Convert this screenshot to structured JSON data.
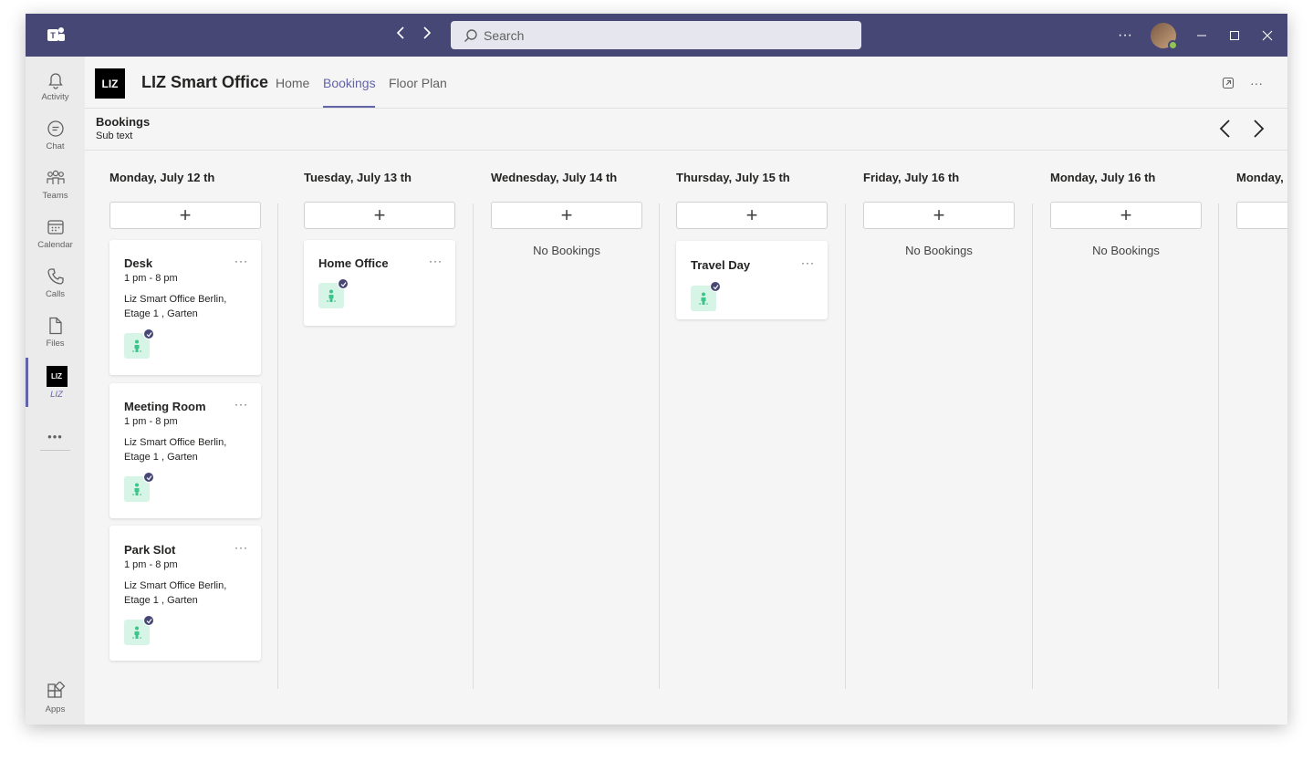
{
  "titlebar": {
    "search_placeholder": "Search",
    "more": "···"
  },
  "rail": {
    "items": [
      {
        "label": "Activity",
        "icon": "bell-icon"
      },
      {
        "label": "Chat",
        "icon": "chat-icon"
      },
      {
        "label": "Teams",
        "icon": "teams-icon"
      },
      {
        "label": "Calendar",
        "icon": "calendar-icon"
      },
      {
        "label": "Calls",
        "icon": "phone-icon"
      },
      {
        "label": "Files",
        "icon": "file-icon"
      },
      {
        "label": "LIZ",
        "icon": "liz-icon"
      },
      {
        "label": "Apps",
        "icon": "apps-icon"
      }
    ],
    "more": "•••",
    "liz_mark": "LIZ"
  },
  "header": {
    "logo_text": "LIZ",
    "title": "LIZ Smart Office",
    "tabs": [
      {
        "label": "Home"
      },
      {
        "label": "Bookings"
      },
      {
        "label": "Floor Plan"
      }
    ],
    "more": "···"
  },
  "subheader": {
    "title": "Bookings",
    "subtext": "Sub text"
  },
  "days": [
    {
      "title": "Monday, July 12 th"
    },
    {
      "title": "Tuesday, July 13 th"
    },
    {
      "title": "Wednesday, July 14 th",
      "empty": "No Bookings"
    },
    {
      "title": "Thursday, July 15 th"
    },
    {
      "title": "Friday, July 16 th",
      "empty": "No Bookings"
    },
    {
      "title": "Monday, July 16 th",
      "empty": "No Bookings"
    },
    {
      "title": "Monday,"
    }
  ],
  "bookings": {
    "desk": {
      "title": "Desk",
      "time": "1 pm - 8 pm",
      "location": "Liz Smart Office Berlin, Etage 1 , Garten"
    },
    "meeting": {
      "title": "Meeting Room",
      "time": "1 pm - 8 pm",
      "location": "Liz Smart Office Berlin, Etage 1 , Garten"
    },
    "park": {
      "title": "Park Slot",
      "time": "1 pm - 8 pm",
      "location": "Liz Smart Office Berlin, Etage 1 , Garten"
    },
    "home": {
      "title": "Home Office"
    },
    "travel": {
      "title": "Travel Day"
    }
  },
  "add_label": "+",
  "card_more": "···",
  "colors": {
    "titlebar": "#464775",
    "accent": "#6264a7",
    "status_bg": "#d7f5e6",
    "status_person": "#3cc48a"
  }
}
